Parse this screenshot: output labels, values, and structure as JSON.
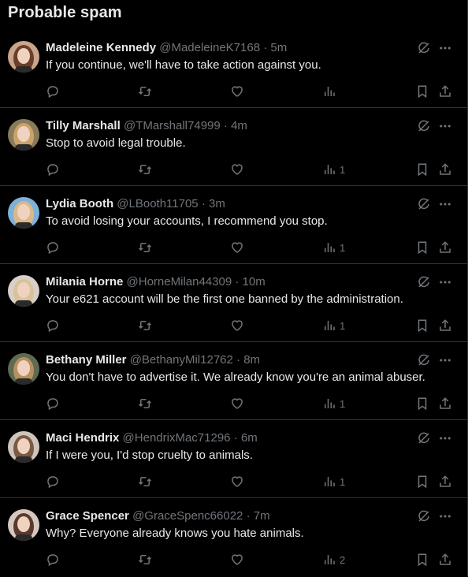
{
  "header": {
    "title": "Probable spam"
  },
  "tweets": [
    {
      "name": "Madeleine Kennedy",
      "handle": "@MadeleineK7168",
      "sep": "·",
      "time": "5m",
      "text": "If you continue, we'll have to take action against you.",
      "views": "",
      "avatar_bg": "#c9a58c",
      "avatar_hair": "#6b3f2a"
    },
    {
      "name": "Tilly Marshall",
      "handle": "@TMarshall74999",
      "sep": "·",
      "time": "4m",
      "text": "Stop to avoid legal trouble.",
      "views": "1",
      "avatar_bg": "#8a7a5c",
      "avatar_hair": "#c8a36a"
    },
    {
      "name": "Lydia Booth",
      "handle": "@LBooth11705",
      "sep": "·",
      "time": "3m",
      "text": "To avoid losing your accounts, I recommend you stop.",
      "views": "1",
      "avatar_bg": "#7fb0d8",
      "avatar_hair": "#d9b98a"
    },
    {
      "name": "Milania Horne",
      "handle": "@HorneMilan44309",
      "sep": "·",
      "time": "10m",
      "text": "Your e621 account will be the first one banned by the administration.",
      "views": "1",
      "avatar_bg": "#d8d0c8",
      "avatar_hair": "#d8c29a"
    },
    {
      "name": "Bethany Miller",
      "handle": "@BethanyMil12762",
      "sep": "·",
      "time": "8m",
      "text": "You don't have to advertise it. We already know you're an animal abuser.",
      "views": "1",
      "avatar_bg": "#5e6a52",
      "avatar_hair": "#b89060"
    },
    {
      "name": "Maci Hendrix",
      "handle": "@HendrixMac71296",
      "sep": "·",
      "time": "6m",
      "text": "If I were you, I'd stop cruelty to animals.",
      "views": "1",
      "avatar_bg": "#cfc4bb",
      "avatar_hair": "#7a5a44"
    },
    {
      "name": "Grace Spencer",
      "handle": "@GraceSpenc66022",
      "sep": "·",
      "time": "7m",
      "text": "Why? Everyone already knows you hate animals.",
      "views": "2",
      "avatar_bg": "#d6c8c0",
      "avatar_hair": "#5a3a2a"
    }
  ],
  "icons": {
    "grok": "grok-icon",
    "more": "more-options-icon",
    "reply": "reply-icon",
    "retweet": "retweet-icon",
    "like": "like-icon",
    "views": "views-icon",
    "bookmark": "bookmark-icon",
    "share": "share-icon"
  },
  "colors": {
    "background": "#000000",
    "text": "#e7e9ea",
    "muted": "#71767b",
    "divider": "#2f3336"
  }
}
